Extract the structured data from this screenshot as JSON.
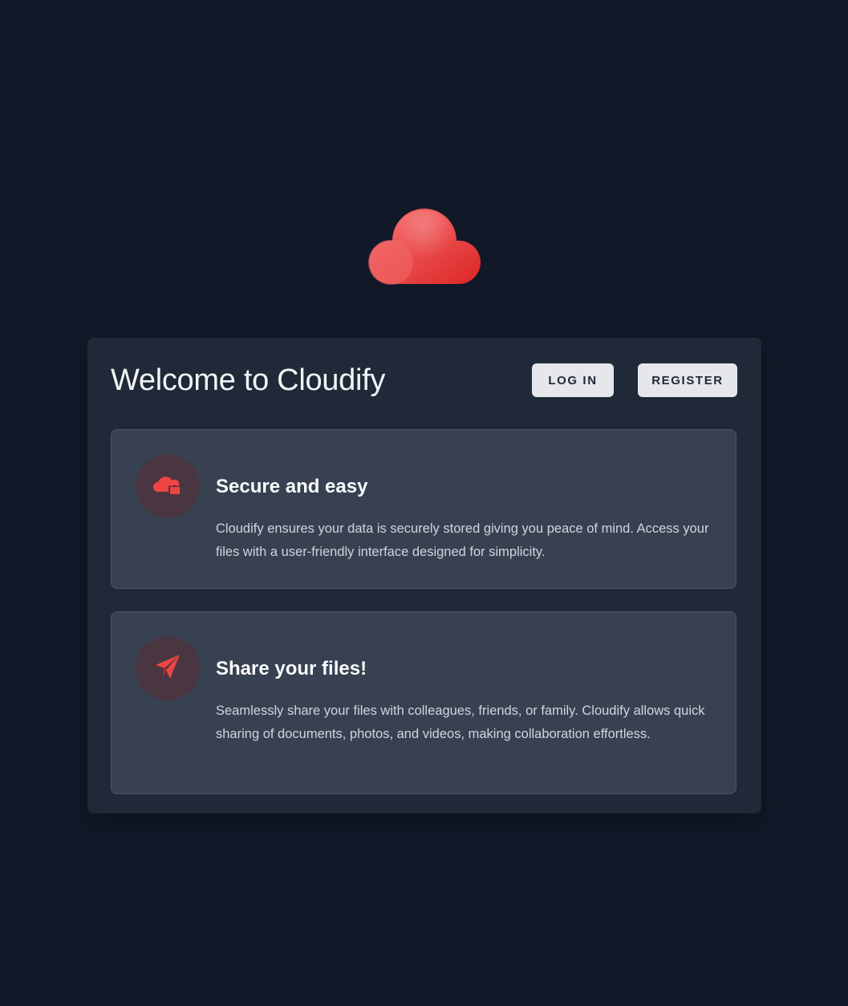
{
  "app": {
    "logo_icon": "cloud-logo-icon",
    "accent_color": "#ef4444"
  },
  "header": {
    "title": "Welcome to Cloudify",
    "login_label": "LOG IN",
    "register_label": "REGISTER"
  },
  "features": [
    {
      "icon": "cloud-lock-icon",
      "title": "Secure and easy",
      "text": "Cloudify ensures your data is securely stored giving you peace of mind. Access your files with a user-friendly interface designed for simplicity."
    },
    {
      "icon": "paper-plane-icon",
      "title": "Share your files!",
      "text": "Seamlessly share your files with colleagues, friends, or family. Cloudify allows quick sharing of documents, photos, and videos, making collaboration effortless."
    }
  ]
}
